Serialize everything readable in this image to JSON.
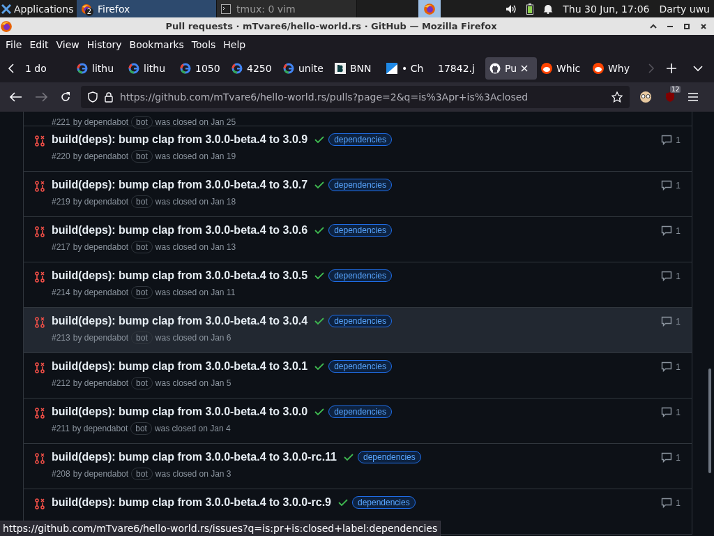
{
  "desktop_panel": {
    "items": [
      {
        "kind": "launcher",
        "label": "Applications",
        "selected": false
      },
      {
        "kind": "task",
        "label": "Firefox",
        "badge": "2",
        "selected": true
      },
      {
        "kind": "task",
        "label": "tmux: 0 vim",
        "selected": false
      },
      {
        "kind": "icon",
        "selected": true
      }
    ],
    "clock": "Thu 30 Jun, 17:06",
    "user": "Darty uwu"
  },
  "window": {
    "title": "Pull requests · mTvare6/hello-world.rs · GitHub — Mozilla Firefox"
  },
  "menu": [
    "File",
    "Edit",
    "View",
    "History",
    "Bookmarks",
    "Tools",
    "Help"
  ],
  "tabs": [
    {
      "label": "1 do",
      "kind": "plain",
      "selected": false
    },
    {
      "label": "lithu",
      "kind": "google",
      "selected": false
    },
    {
      "label": "lithu",
      "kind": "google",
      "selected": false
    },
    {
      "label": "1050",
      "kind": "google",
      "selected": false
    },
    {
      "label": "4250",
      "kind": "google",
      "selected": false
    },
    {
      "label": "unite",
      "kind": "google",
      "selected": false
    },
    {
      "label": "BNN",
      "kind": "bnn",
      "selected": false
    },
    {
      "label": "• Ch",
      "kind": "chart",
      "selected": false
    },
    {
      "label": "17842.j",
      "kind": "plain",
      "selected": false
    },
    {
      "label": "Pu",
      "kind": "github",
      "selected": true
    },
    {
      "label": "Whic",
      "kind": "reddit",
      "selected": false
    },
    {
      "label": "Why",
      "kind": "reddit",
      "selected": false
    }
  ],
  "navbar": {
    "url": "https://github.com/mTvare6/hello-world.rs/pulls?page=2&q=is%3Apr+is%3Aclosed",
    "extension_badge": "12"
  },
  "pull_requests": [
    {
      "meta": {
        "number": "#221",
        "by": "by dependabot",
        "badge": "bot",
        "closed": "was closed on Jan 25"
      },
      "hovered": false
    },
    {
      "title": "build(deps): bump clap from 3.0.0-beta.4 to 3.0.9",
      "checks_passed": true,
      "label": "dependencies",
      "meta": {
        "number": "#220",
        "by": "by dependabot",
        "badge": "bot",
        "closed": "was closed on Jan 19"
      },
      "comments": "1",
      "hovered": false
    },
    {
      "title": "build(deps): bump clap from 3.0.0-beta.4 to 3.0.7",
      "checks_passed": true,
      "label": "dependencies",
      "meta": {
        "number": "#219",
        "by": "by dependabot",
        "badge": "bot",
        "closed": "was closed on Jan 18"
      },
      "comments": "1",
      "hovered": false
    },
    {
      "title": "build(deps): bump clap from 3.0.0-beta.4 to 3.0.6",
      "checks_passed": true,
      "label": "dependencies",
      "meta": {
        "number": "#217",
        "by": "by dependabot",
        "badge": "bot",
        "closed": "was closed on Jan 13"
      },
      "comments": "1",
      "hovered": false
    },
    {
      "title": "build(deps): bump clap from 3.0.0-beta.4 to 3.0.5",
      "checks_passed": true,
      "label": "dependencies",
      "meta": {
        "number": "#214",
        "by": "by dependabot",
        "badge": "bot",
        "closed": "was closed on Jan 11"
      },
      "comments": "1",
      "hovered": false
    },
    {
      "title": "build(deps): bump clap from 3.0.0-beta.4 to 3.0.4",
      "checks_passed": true,
      "label": "dependencies",
      "meta": {
        "number": "#213",
        "by": "by dependabot",
        "badge": "bot",
        "closed": "was closed on Jan 6"
      },
      "comments": "1",
      "hovered": true
    },
    {
      "title": "build(deps): bump clap from 3.0.0-beta.4 to 3.0.1",
      "checks_passed": true,
      "label": "dependencies",
      "meta": {
        "number": "#212",
        "by": "by dependabot",
        "badge": "bot",
        "closed": "was closed on Jan 5"
      },
      "comments": "1",
      "hovered": false
    },
    {
      "title": "build(deps): bump clap from 3.0.0-beta.4 to 3.0.0",
      "checks_passed": true,
      "label": "dependencies",
      "meta": {
        "number": "#211",
        "by": "by dependabot",
        "badge": "bot",
        "closed": "was closed on Jan 4"
      },
      "comments": "1",
      "hovered": false
    },
    {
      "title": "build(deps): bump clap from 3.0.0-beta.4 to 3.0.0-rc.11",
      "checks_passed": true,
      "label": "dependencies",
      "meta": {
        "number": "#208",
        "by": "by dependabot",
        "badge": "bot",
        "closed": "was closed on Jan 3"
      },
      "comments": "1",
      "hovered": false
    },
    {
      "title": "build(deps): bump clap from 3.0.0-beta.4 to 3.0.0-rc.9",
      "checks_passed": true,
      "label": "dependencies",
      "comments": "1",
      "hovered": false
    }
  ],
  "status_tooltip": "https://github.com/mTvare6/hello-world.rs/issues?q=is:pr+is:closed+label:dependencies"
}
